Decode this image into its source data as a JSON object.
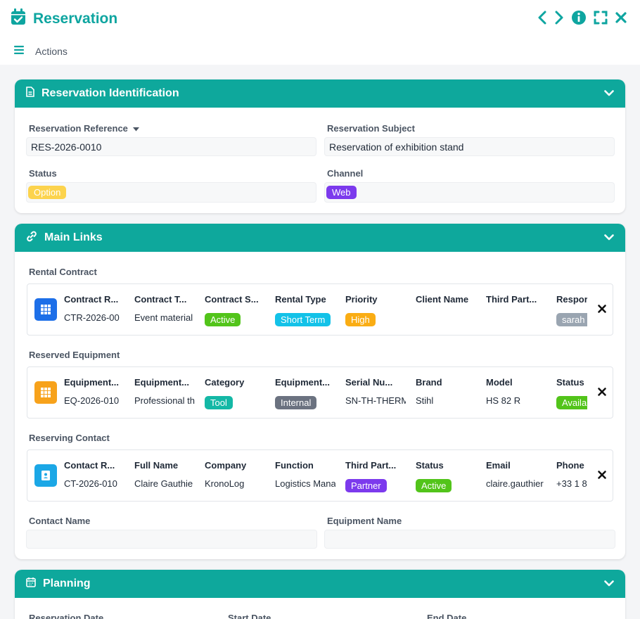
{
  "window": {
    "title": "Reservation",
    "icon": "calendar-check-icon",
    "accent": "#0ea5a0"
  },
  "toolbar": {
    "actions_label": "Actions"
  },
  "identification": {
    "title": "Reservation Identification",
    "reference_label": "Reservation Reference",
    "reference_value": "RES-2026-0010",
    "subject_label": "Reservation Subject",
    "subject_value": "Reservation of exhibition stand",
    "status_label": "Status",
    "status_value": "Option",
    "status_color": "#fcd34d",
    "channel_label": "Channel",
    "channel_value": "Web",
    "channel_color": "#7c3aed"
  },
  "main_links": {
    "title": "Main Links",
    "rental_contract": {
      "label": "Rental Contract",
      "icon_color": "#1d6fe8",
      "columns": [
        {
          "header": "Contract R...",
          "value": "CTR-2026-00"
        },
        {
          "header": "Contract T...",
          "value": "Event material"
        },
        {
          "header": "Contract S...",
          "badge": "Active",
          "color": "#52c41a"
        },
        {
          "header": "Rental Type",
          "badge": "Short Term",
          "color": "#13c2e8"
        },
        {
          "header": "Priority",
          "badge": "High",
          "color": "#faad14"
        },
        {
          "header": "Client Name",
          "value": ""
        },
        {
          "header": "Third Part...",
          "value": ""
        },
        {
          "header": "Respor",
          "badge": "sarah",
          "color": "#9aa5b1"
        }
      ]
    },
    "reserved_equipment": {
      "label": "Reserved Equipment",
      "icon_color": "#f7a21b",
      "columns": [
        {
          "header": "Equipment...",
          "value": "EQ-2026-010"
        },
        {
          "header": "Equipment...",
          "value": "Professional th"
        },
        {
          "header": "Category",
          "badge": "Tool",
          "color": "#14b8a6"
        },
        {
          "header": "Equipment...",
          "badge": "Internal",
          "color": "#6b7280"
        },
        {
          "header": "Serial Nu...",
          "value": "SN-TH-THERM"
        },
        {
          "header": "Brand",
          "value": "Stihl"
        },
        {
          "header": "Model",
          "value": "HS 82 R"
        },
        {
          "header": "Status",
          "badge": "Availa",
          "color": "#52c41a"
        }
      ]
    },
    "reserving_contact": {
      "label": "Reserving Contact",
      "icon_color": "#1ba7e6",
      "columns": [
        {
          "header": "Contact R...",
          "value": "CT-2026-010"
        },
        {
          "header": "Full Name",
          "value": "Claire Gauthie"
        },
        {
          "header": "Company",
          "value": "KronoLog"
        },
        {
          "header": "Function",
          "value": "Logistics Mana"
        },
        {
          "header": "Third Part...",
          "badge": "Partner",
          "color": "#7c3aed"
        },
        {
          "header": "Status",
          "badge": "Active",
          "color": "#52c41a"
        },
        {
          "header": "Email",
          "value": "claire.gauthier"
        },
        {
          "header": "Phone",
          "value": "+33 1 8"
        }
      ]
    },
    "contact_name_label": "Contact Name",
    "contact_name_value": "",
    "equipment_name_label": "Equipment Name",
    "equipment_name_value": ""
  },
  "planning": {
    "title": "Planning",
    "reservation_date_label": "Reservation Date",
    "start_date_label": "Start Date",
    "end_date_label": "End Date"
  }
}
